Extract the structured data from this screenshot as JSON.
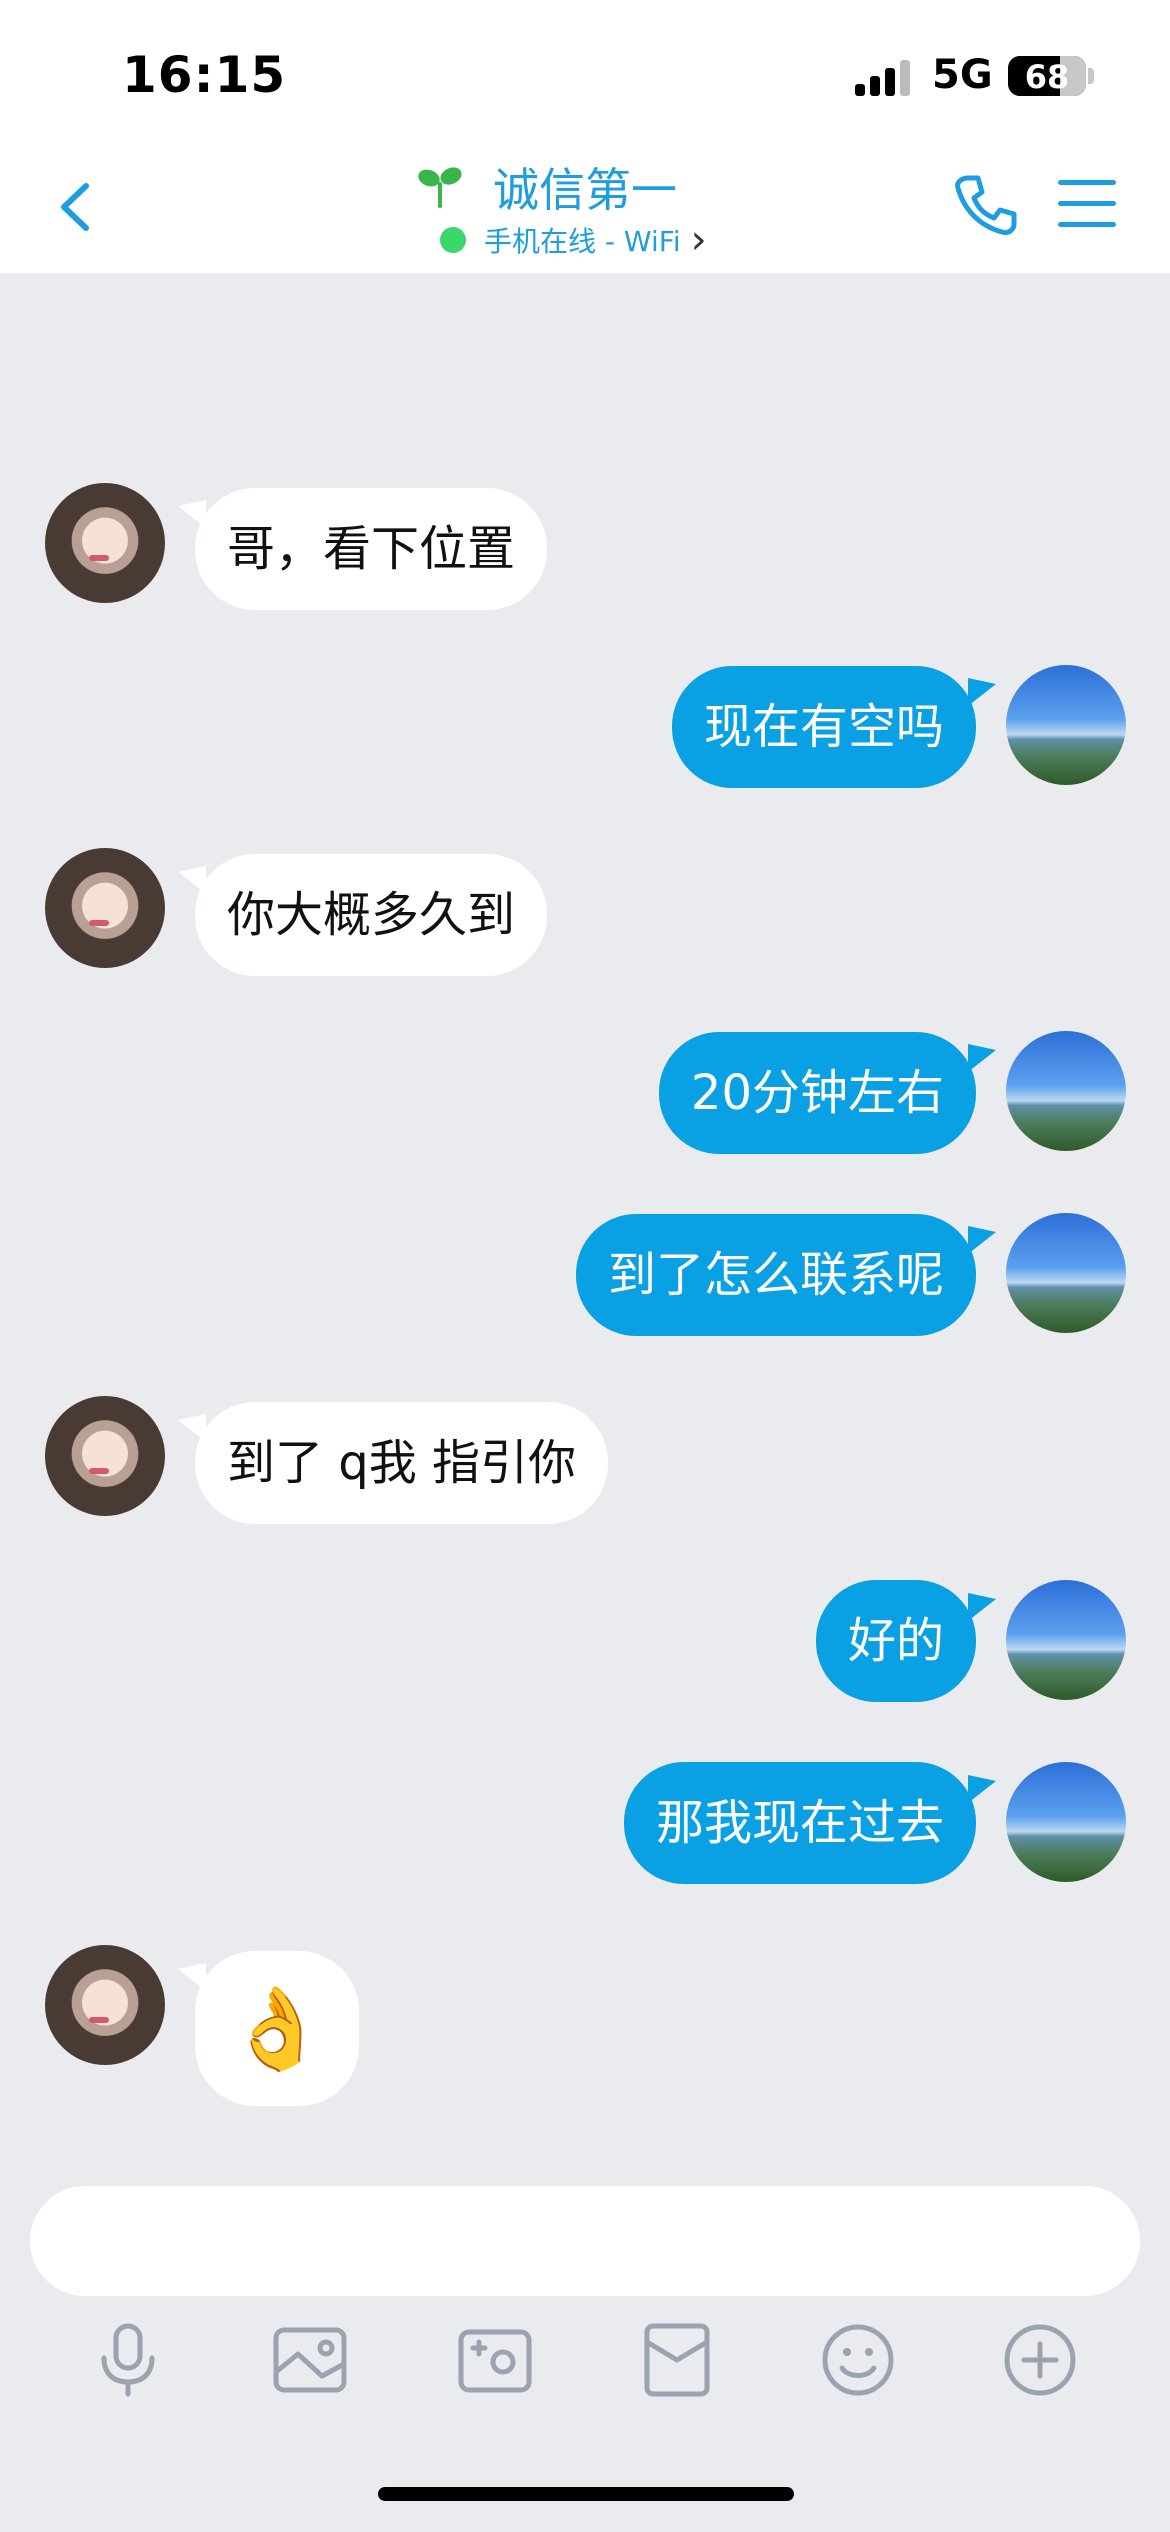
{
  "status_bar": {
    "time": "16:15",
    "network": "5G",
    "battery": "68"
  },
  "nav": {
    "title": "诚信第一",
    "status": "手机在线 - WiFi",
    "chevron": "›"
  },
  "messages": [
    {
      "side": "in",
      "text": "哥，看下位置"
    },
    {
      "side": "out",
      "text": "现在有空吗"
    },
    {
      "side": "in",
      "text": "你大概多久到"
    },
    {
      "side": "out",
      "text": "20分钟左右"
    },
    {
      "side": "out",
      "text": "到了怎么联系呢"
    },
    {
      "side": "in",
      "text": "到了 q我 指引你"
    },
    {
      "side": "out",
      "text": "好的"
    },
    {
      "side": "out",
      "text": "那我现在过去"
    },
    {
      "side": "in",
      "text": "👌"
    }
  ],
  "input": {
    "placeholder": ""
  },
  "toolbar": [
    "mic-icon",
    "image-icon",
    "camera-icon",
    "red-packet-icon",
    "emoji-icon",
    "plus-icon"
  ],
  "colors": {
    "accent": "#1e9de0",
    "bubble_out": "#0aa0e4",
    "bubble_in": "#ffffff",
    "background": "#eaebef"
  }
}
